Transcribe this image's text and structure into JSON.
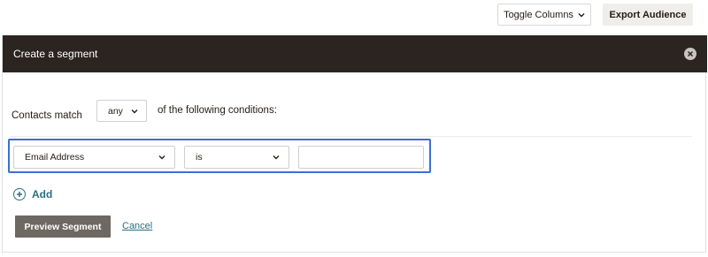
{
  "toolbar": {
    "toggle_columns_label": "Toggle Columns",
    "export_label": "Export Audience"
  },
  "segment_panel": {
    "title": "Create a segment",
    "match_prefix": "Contacts match",
    "match_value": "any",
    "match_suffix": "of the following conditions:",
    "condition": {
      "field": "Email Address",
      "operator": "is",
      "value": ""
    },
    "add_label": "Add",
    "preview_label": "Preview Segment",
    "cancel_label": "Cancel"
  },
  "colors": {
    "header_bg": "#2b2420",
    "accent_link": "#2a6f81",
    "focus_border": "#3a70d4",
    "primary_button": "#6d6862"
  }
}
